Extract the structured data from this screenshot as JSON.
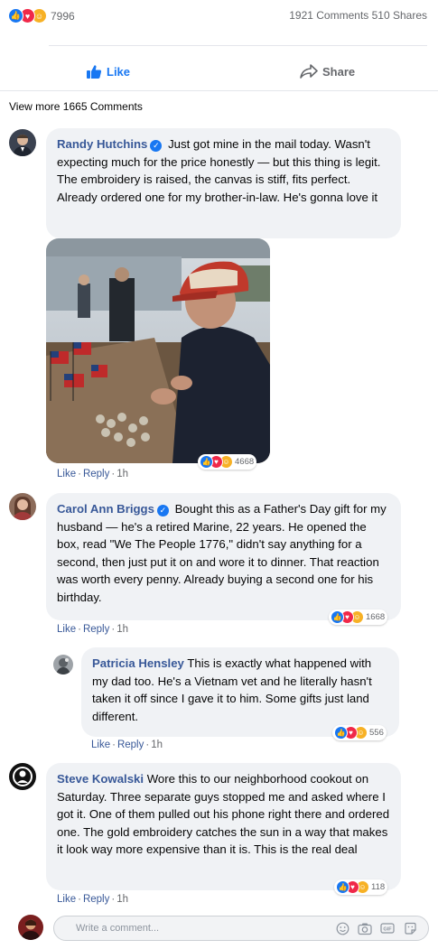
{
  "post_stats": {
    "reaction_count": "7996",
    "comments_shares": "1921 Comments 510 Shares"
  },
  "actions": {
    "like_label": "Like",
    "share_label": "Share"
  },
  "view_more": "View more 1665 Comments",
  "comments": [
    {
      "author": "Randy Hutchins",
      "verified": true,
      "text": "Just got mine in the mail today. Wasn't expecting much for the price honestly — but this thing is legit. The embroidery is raised, the canvas is stiff, fits perfect. Already ordered one for my brother-in-law. He's gonna love it",
      "like": "Like",
      "reply": "Reply",
      "time": "1h",
      "reaction_count": "4668"
    },
    {
      "author": "Carol Ann Briggs",
      "verified": true,
      "text": "Bought this as a Father's Day gift for my husband — he's a retired Marine, 22 years. He opened the box, read \"We The People 1776,\" didn't say anything for a second, then just put it on and wore it to dinner. That reaction was worth every penny. Already buying a second one for his birthday.",
      "like": "Like",
      "reply": "Reply",
      "time": "1h",
      "reaction_count": "1668"
    },
    {
      "author": "Patricia Hensley",
      "verified": false,
      "text": "This is exactly what happened with my dad too. He's a Vietnam vet and he literally hasn't taken it off since I gave it to him. Some gifts just land different.",
      "like": "Like",
      "reply": "Reply",
      "time": "1h",
      "reaction_count": "556"
    },
    {
      "author": "Steve Kowalski",
      "verified": false,
      "text": "Wore this to our neighborhood cookout on Saturday. Three separate guys stopped me and asked where I got it. One of them pulled out his phone right there and ordered one. The gold embroidery catches the sun in a way that makes it look way more expensive than it is. This is the real deal",
      "like": "Like",
      "reply": "Reply",
      "time": "1h",
      "reaction_count": "118"
    }
  ],
  "composer": {
    "placeholder": "Write a comment..."
  },
  "colors": {
    "brand_blue": "#1877f2",
    "link_blue": "#385898",
    "bubble_gray": "#f0f2f5",
    "love_red": "#f02849",
    "haha_yellow": "#f7b125"
  }
}
